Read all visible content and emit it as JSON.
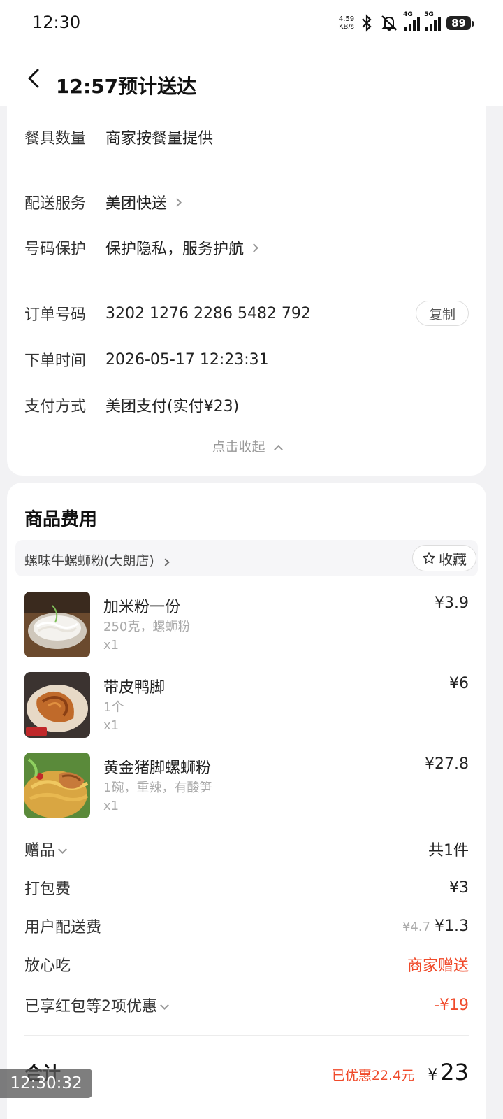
{
  "status_bar": {
    "time": "12:30",
    "net_speed_value": "4.59",
    "net_speed_unit": "KB/s",
    "signal_1_label": "4G",
    "signal_2_label": "5G",
    "battery": "89"
  },
  "header": {
    "title": "12:57预计送达"
  },
  "order_info": {
    "rows": [
      {
        "label": "餐具数量",
        "value": "商家按餐量提供"
      },
      {
        "label": "配送服务",
        "value": "美团快送"
      },
      {
        "label": "号码保护",
        "value": "保护隐私，服务护航"
      },
      {
        "label": "订单号码",
        "value": "3202 1276 2286 5482 792"
      },
      {
        "label": "下单时间",
        "value": "2026-05-17 12:23:31"
      },
      {
        "label": "支付方式",
        "value": "美团支付(实付¥23)"
      }
    ],
    "copy_label": "复制",
    "collapse_label": "点击收起"
  },
  "goods": {
    "title": "商品费用",
    "shop_name": "螺味牛螺蛳粉(大朗店)",
    "favorite_label": "收藏",
    "items": [
      {
        "name": "加米粉一份",
        "spec": "250克，螺蛳粉",
        "qty": "x1",
        "price": "¥3.9"
      },
      {
        "name": "带皮鸭脚",
        "spec": "1个",
        "qty": "x1",
        "price": "¥6"
      },
      {
        "name": "黄金猪脚螺蛳粉",
        "spec": "1碗，重辣，有酸笋",
        "qty": "x1",
        "price": "¥27.8"
      }
    ],
    "fees": {
      "gift_label": "赠品",
      "gift_value": "共1件",
      "packing_label": "打包费",
      "packing_value": "¥3",
      "delivery_label": "用户配送费",
      "delivery_original": "¥4.7",
      "delivery_value": "¥1.3",
      "safe_label": "放心吃",
      "safe_value": "商家赠送",
      "discount_label": "已享红包等2项优惠",
      "discount_value": "-¥19"
    },
    "total": {
      "label": "合计",
      "saved": "已优惠22.4元",
      "currency": "¥",
      "amount": "23"
    }
  },
  "screenshot_timestamp": "12:30:32",
  "colors": {
    "accent_red": "#f04a2a",
    "page_bg": "#f2f2f4"
  }
}
